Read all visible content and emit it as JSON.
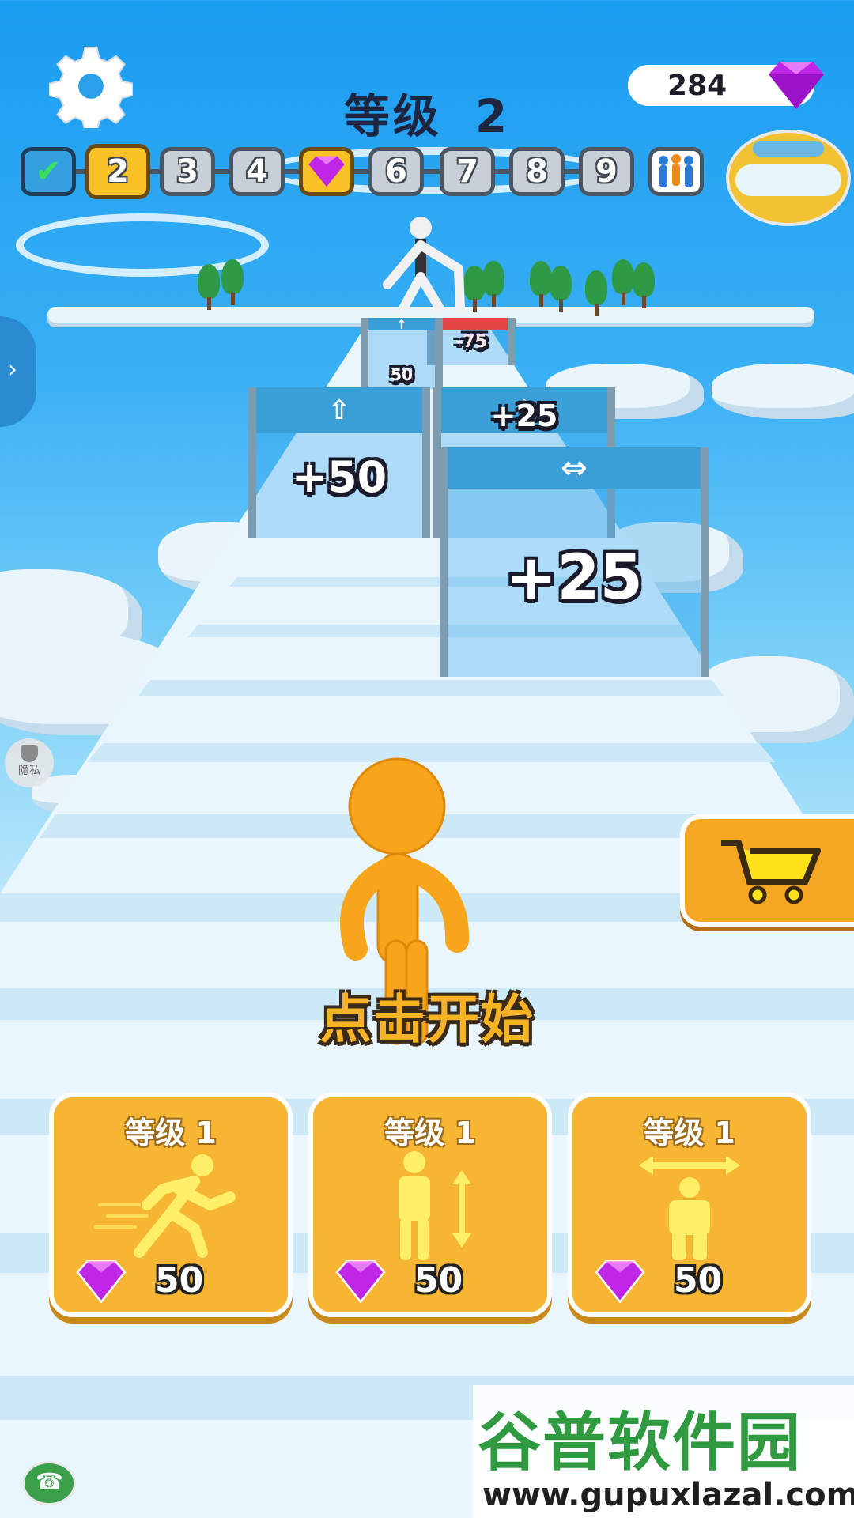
{
  "hud": {
    "level_title_word": "等级",
    "level_title_num": "2",
    "gems": "284"
  },
  "progress": {
    "nodes": [
      {
        "label": "✔",
        "state": "done"
      },
      {
        "label": "2",
        "state": "current"
      },
      {
        "label": "3",
        "state": "locked"
      },
      {
        "label": "4",
        "state": "locked"
      },
      {
        "label": "",
        "state": "gem"
      },
      {
        "label": "6",
        "state": "locked"
      },
      {
        "label": "7",
        "state": "locked"
      },
      {
        "label": "8",
        "state": "locked"
      },
      {
        "label": "9",
        "state": "locked"
      }
    ]
  },
  "gates": {
    "far": "-75",
    "mid_left": "+50",
    "mid_right": "+25",
    "near": "+25",
    "hidden_behind": "50"
  },
  "privacy_label": "隐私",
  "tap_to_start": "点击开始",
  "upgrades": [
    {
      "level": "等级 1",
      "icon": "speed-runner-icon",
      "price": "50"
    },
    {
      "level": "等级 1",
      "icon": "height-icon",
      "price": "50"
    },
    {
      "level": "等级 1",
      "icon": "width-icon",
      "price": "50"
    }
  ],
  "watermark": {
    "brand": "谷普软件园",
    "url": "www.gupuxlazal.com"
  },
  "colors": {
    "accent": "#f6b532",
    "gem": "#c026e6",
    "sky": "#1a9cf0"
  }
}
